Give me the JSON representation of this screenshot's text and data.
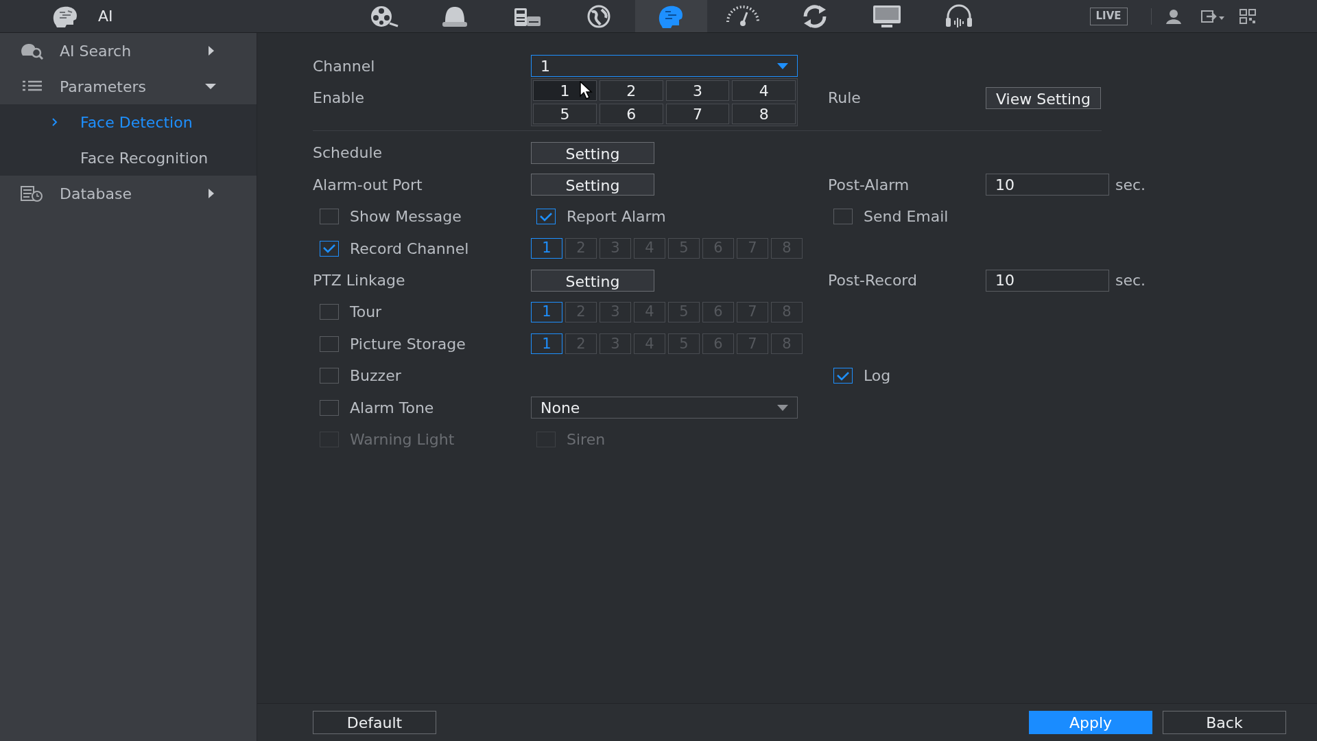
{
  "header": {
    "title": "AI",
    "live": "LIVE"
  },
  "top_nav": [
    {
      "selected": false
    },
    {
      "selected": false
    },
    {
      "selected": false
    },
    {
      "selected": false
    },
    {
      "selected": true
    },
    {
      "selected": false
    },
    {
      "selected": false
    },
    {
      "selected": false
    },
    {
      "selected": false
    }
  ],
  "sidebar": {
    "items": [
      {
        "label": "AI Search",
        "expanded": false
      },
      {
        "label": "Parameters",
        "expanded": true,
        "children": [
          {
            "label": "Face Detection",
            "selected": true
          },
          {
            "label": "Face Recognition",
            "selected": false
          }
        ]
      },
      {
        "label": "Database",
        "expanded": false
      }
    ]
  },
  "form": {
    "rows": [
      {
        "left": {
          "kind": "label",
          "text": "Channel"
        },
        "middle": {
          "kind": "select",
          "value": "1",
          "expanded": true,
          "options": [
            {
              "label": "1",
              "selected": true
            },
            {
              "label": "2",
              "selected": false
            },
            {
              "label": "3",
              "selected": false
            },
            {
              "label": "4",
              "selected": false
            },
            {
              "label": "5",
              "selected": false
            },
            {
              "label": "6",
              "selected": false
            },
            {
              "label": "7",
              "selected": false
            },
            {
              "label": "8",
              "selected": false
            }
          ]
        }
      },
      {
        "left": {
          "kind": "label",
          "text": "Enable"
        },
        "right": {
          "kind": "button",
          "label": "Rule",
          "button": "View Setting"
        }
      },
      {
        "kind": "divider"
      },
      {
        "left": {
          "kind": "label",
          "text": "Schedule"
        },
        "middle": {
          "kind": "button",
          "label": "Setting"
        }
      },
      {
        "left": {
          "kind": "label",
          "text": "Alarm-out Port"
        },
        "middle": {
          "kind": "button",
          "label": "Setting"
        },
        "right": {
          "kind": "number",
          "label": "Post-Alarm",
          "value": "10",
          "unit": "sec."
        }
      },
      {
        "left": {
          "kind": "checkbox",
          "label": "Show Message",
          "checked": false,
          "disabled": false
        },
        "middle": {
          "kind": "checkbox",
          "label": "Report Alarm",
          "checked": true,
          "disabled": false
        },
        "right": {
          "kind": "checkbox",
          "label": "Send Email",
          "checked": false,
          "disabled": false
        }
      },
      {
        "left": {
          "kind": "checkbox",
          "label": "Record Channel",
          "checked": true,
          "disabled": false
        },
        "middle": {
          "kind": "channels",
          "items": [
            {
              "label": "1",
              "selected": true
            },
            {
              "label": "2",
              "selected": false
            },
            {
              "label": "3",
              "selected": false
            },
            {
              "label": "4",
              "selected": false
            },
            {
              "label": "5",
              "selected": false
            },
            {
              "label": "6",
              "selected": false
            },
            {
              "label": "7",
              "selected": false
            },
            {
              "label": "8",
              "selected": false
            }
          ]
        }
      },
      {
        "left": {
          "kind": "label",
          "text": "PTZ Linkage"
        },
        "middle": {
          "kind": "button",
          "label": "Setting"
        },
        "right": {
          "kind": "number",
          "label": "Post-Record",
          "value": "10",
          "unit": "sec."
        }
      },
      {
        "left": {
          "kind": "checkbox",
          "label": "Tour",
          "checked": false,
          "disabled": false
        },
        "middle": {
          "kind": "channels",
          "items": [
            {
              "label": "1",
              "selected": true
            },
            {
              "label": "2",
              "selected": false
            },
            {
              "label": "3",
              "selected": false
            },
            {
              "label": "4",
              "selected": false
            },
            {
              "label": "5",
              "selected": false
            },
            {
              "label": "6",
              "selected": false
            },
            {
              "label": "7",
              "selected": false
            },
            {
              "label": "8",
              "selected": false
            }
          ]
        }
      },
      {
        "left": {
          "kind": "checkbox",
          "label": "Picture Storage",
          "checked": false,
          "disabled": false
        },
        "middle": {
          "kind": "channels",
          "items": [
            {
              "label": "1",
              "selected": true
            },
            {
              "label": "2",
              "selected": false
            },
            {
              "label": "3",
              "selected": false
            },
            {
              "label": "4",
              "selected": false
            },
            {
              "label": "5",
              "selected": false
            },
            {
              "label": "6",
              "selected": false
            },
            {
              "label": "7",
              "selected": false
            },
            {
              "label": "8",
              "selected": false
            }
          ]
        }
      },
      {
        "left": {
          "kind": "checkbox",
          "label": "Buzzer",
          "checked": false,
          "disabled": false
        },
        "right": {
          "kind": "checkbox",
          "label": "Log",
          "checked": true,
          "disabled": false
        }
      },
      {
        "left": {
          "kind": "checkbox",
          "label": "Alarm Tone",
          "checked": false,
          "disabled": false
        },
        "middle": {
          "kind": "select",
          "value": "None",
          "expanded": false
        }
      },
      {
        "left": {
          "kind": "checkbox",
          "label": "Warning Light",
          "checked": false,
          "disabled": true
        },
        "middle": {
          "kind": "checkbox",
          "label": "Siren",
          "checked": false,
          "disabled": true
        }
      }
    ]
  },
  "footer": {
    "buttons": [
      {
        "label": "Default",
        "kind": "plain"
      },
      {
        "label": "Apply",
        "kind": "primary"
      },
      {
        "label": "Back",
        "kind": "plain"
      }
    ]
  }
}
